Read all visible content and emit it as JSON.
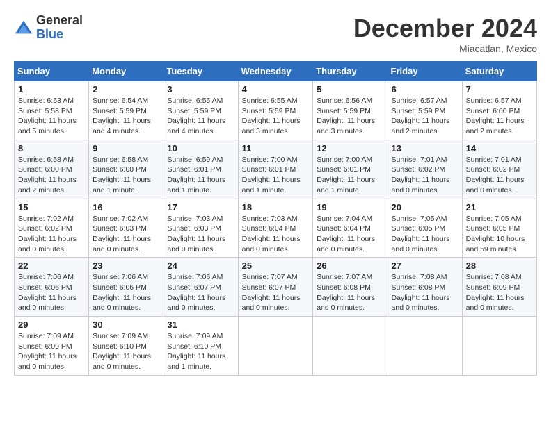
{
  "header": {
    "logo_general": "General",
    "logo_blue": "Blue",
    "month_title": "December 2024",
    "location": "Miacatlan, Mexico"
  },
  "calendar": {
    "days_of_week": [
      "Sunday",
      "Monday",
      "Tuesday",
      "Wednesday",
      "Thursday",
      "Friday",
      "Saturday"
    ],
    "weeks": [
      [
        {
          "day": "1",
          "info": "Sunrise: 6:53 AM\nSunset: 5:58 PM\nDaylight: 11 hours and 5 minutes."
        },
        {
          "day": "2",
          "info": "Sunrise: 6:54 AM\nSunset: 5:59 PM\nDaylight: 11 hours and 4 minutes."
        },
        {
          "day": "3",
          "info": "Sunrise: 6:55 AM\nSunset: 5:59 PM\nDaylight: 11 hours and 4 minutes."
        },
        {
          "day": "4",
          "info": "Sunrise: 6:55 AM\nSunset: 5:59 PM\nDaylight: 11 hours and 3 minutes."
        },
        {
          "day": "5",
          "info": "Sunrise: 6:56 AM\nSunset: 5:59 PM\nDaylight: 11 hours and 3 minutes."
        },
        {
          "day": "6",
          "info": "Sunrise: 6:57 AM\nSunset: 5:59 PM\nDaylight: 11 hours and 2 minutes."
        },
        {
          "day": "7",
          "info": "Sunrise: 6:57 AM\nSunset: 6:00 PM\nDaylight: 11 hours and 2 minutes."
        }
      ],
      [
        {
          "day": "8",
          "info": "Sunrise: 6:58 AM\nSunset: 6:00 PM\nDaylight: 11 hours and 2 minutes."
        },
        {
          "day": "9",
          "info": "Sunrise: 6:58 AM\nSunset: 6:00 PM\nDaylight: 11 hours and 1 minute."
        },
        {
          "day": "10",
          "info": "Sunrise: 6:59 AM\nSunset: 6:01 PM\nDaylight: 11 hours and 1 minute."
        },
        {
          "day": "11",
          "info": "Sunrise: 7:00 AM\nSunset: 6:01 PM\nDaylight: 11 hours and 1 minute."
        },
        {
          "day": "12",
          "info": "Sunrise: 7:00 AM\nSunset: 6:01 PM\nDaylight: 11 hours and 1 minute."
        },
        {
          "day": "13",
          "info": "Sunrise: 7:01 AM\nSunset: 6:02 PM\nDaylight: 11 hours and 0 minutes."
        },
        {
          "day": "14",
          "info": "Sunrise: 7:01 AM\nSunset: 6:02 PM\nDaylight: 11 hours and 0 minutes."
        }
      ],
      [
        {
          "day": "15",
          "info": "Sunrise: 7:02 AM\nSunset: 6:02 PM\nDaylight: 11 hours and 0 minutes."
        },
        {
          "day": "16",
          "info": "Sunrise: 7:02 AM\nSunset: 6:03 PM\nDaylight: 11 hours and 0 minutes."
        },
        {
          "day": "17",
          "info": "Sunrise: 7:03 AM\nSunset: 6:03 PM\nDaylight: 11 hours and 0 minutes."
        },
        {
          "day": "18",
          "info": "Sunrise: 7:03 AM\nSunset: 6:04 PM\nDaylight: 11 hours and 0 minutes."
        },
        {
          "day": "19",
          "info": "Sunrise: 7:04 AM\nSunset: 6:04 PM\nDaylight: 11 hours and 0 minutes."
        },
        {
          "day": "20",
          "info": "Sunrise: 7:05 AM\nSunset: 6:05 PM\nDaylight: 11 hours and 0 minutes."
        },
        {
          "day": "21",
          "info": "Sunrise: 7:05 AM\nSunset: 6:05 PM\nDaylight: 10 hours and 59 minutes."
        }
      ],
      [
        {
          "day": "22",
          "info": "Sunrise: 7:06 AM\nSunset: 6:06 PM\nDaylight: 11 hours and 0 minutes."
        },
        {
          "day": "23",
          "info": "Sunrise: 7:06 AM\nSunset: 6:06 PM\nDaylight: 11 hours and 0 minutes."
        },
        {
          "day": "24",
          "info": "Sunrise: 7:06 AM\nSunset: 6:07 PM\nDaylight: 11 hours and 0 minutes."
        },
        {
          "day": "25",
          "info": "Sunrise: 7:07 AM\nSunset: 6:07 PM\nDaylight: 11 hours and 0 minutes."
        },
        {
          "day": "26",
          "info": "Sunrise: 7:07 AM\nSunset: 6:08 PM\nDaylight: 11 hours and 0 minutes."
        },
        {
          "day": "27",
          "info": "Sunrise: 7:08 AM\nSunset: 6:08 PM\nDaylight: 11 hours and 0 minutes."
        },
        {
          "day": "28",
          "info": "Sunrise: 7:08 AM\nSunset: 6:09 PM\nDaylight: 11 hours and 0 minutes."
        }
      ],
      [
        {
          "day": "29",
          "info": "Sunrise: 7:09 AM\nSunset: 6:09 PM\nDaylight: 11 hours and 0 minutes."
        },
        {
          "day": "30",
          "info": "Sunrise: 7:09 AM\nSunset: 6:10 PM\nDaylight: 11 hours and 0 minutes."
        },
        {
          "day": "31",
          "info": "Sunrise: 7:09 AM\nSunset: 6:10 PM\nDaylight: 11 hours and 1 minute."
        },
        null,
        null,
        null,
        null
      ]
    ]
  }
}
